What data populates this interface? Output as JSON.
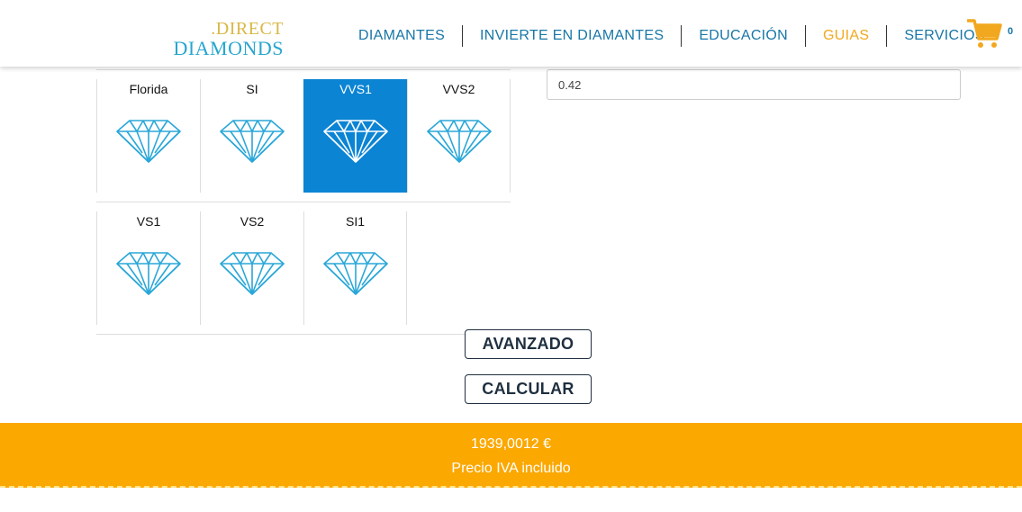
{
  "brand": {
    "logo_top": ".DIRECT",
    "logo_bottom": "DIAMONDS"
  },
  "nav": {
    "items": [
      {
        "label": "DIAMANTES",
        "active": false
      },
      {
        "label": "INVIERTE EN DIAMANTES",
        "active": false
      },
      {
        "label": "EDUCACIÓN",
        "active": false
      },
      {
        "label": "GUIAS",
        "active": true
      },
      {
        "label": "SERVICIOS",
        "active": false
      }
    ]
  },
  "cart": {
    "icon": "cart-icon",
    "count": "0"
  },
  "clarity": {
    "selected": "VVS1",
    "options": [
      "Florida",
      "SI",
      "VVS1",
      "VVS2",
      "VS1",
      "VS2",
      "SI1"
    ]
  },
  "carat_input": {
    "value": "0.42"
  },
  "buttons": {
    "advanced": "AVANZADO",
    "calculate": "CALCULAR"
  },
  "price": {
    "value": "1939,0012 €",
    "note": "Precio IVA incluido"
  },
  "colors": {
    "accent_blue": "#0b84d4",
    "nav_blue": "#1776a7",
    "nav_active": "#f2a81e",
    "price_bar": "#fba800",
    "diamond_stroke": "#2aa7d8"
  }
}
